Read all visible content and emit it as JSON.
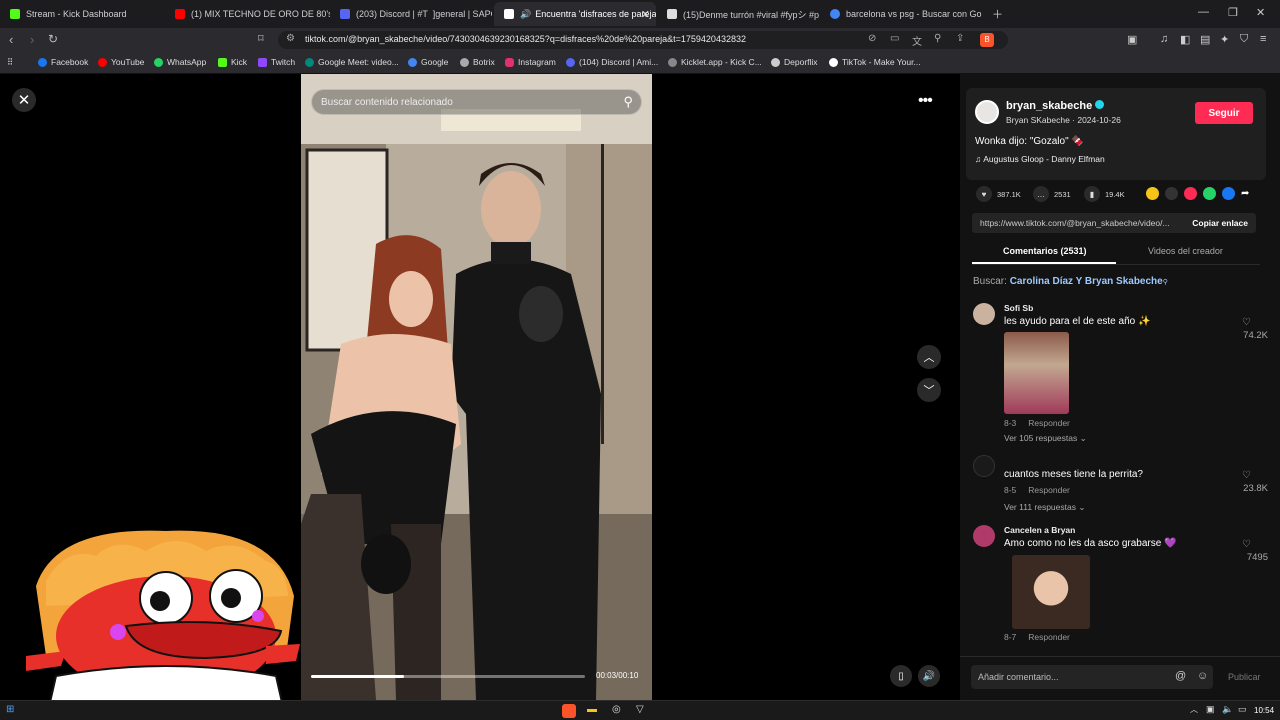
{
  "browser": {
    "tabs": [
      {
        "title": "Stream - Kick Dashboard",
        "color": "#53fc18",
        "active": false
      },
      {
        "title": "(1) MIX TECHNO DE ORO DE 80's &",
        "color": "#ff0000",
        "active": false
      },
      {
        "title": "(203) Discord | #T ⁣ ]general | SAPO",
        "color": "#5865f2",
        "active": false
      },
      {
        "title": "Encuentra 'disfraces de pareja",
        "color": "#ffffff",
        "active": true
      },
      {
        "title": "(15)Denme turrón #viral #fypシ #pen",
        "color": "#ffffff",
        "active": false
      },
      {
        "title": "barcelona vs psg - Buscar con Google",
        "color": "#4285f4",
        "active": false
      }
    ],
    "url": "tiktok.com/@bryan_skabeche/video/7430304639230168325?q=disfraces%20de%20pareja&t=1759420432832",
    "bookmarks": [
      {
        "label": "Facebook",
        "color": "#1877f2"
      },
      {
        "label": "YouTube",
        "color": "#ff0000"
      },
      {
        "label": "WhatsApp",
        "color": "#25d366"
      },
      {
        "label": "Kick",
        "color": "#53fc18"
      },
      {
        "label": "Twitch",
        "color": "#9146ff"
      },
      {
        "label": "Google Meet: video...",
        "color": "#00897b"
      },
      {
        "label": "Google",
        "color": "#4285f4"
      },
      {
        "label": "Botrix",
        "color": "#aaaaaa"
      },
      {
        "label": "Instagram",
        "color": "#e1306c"
      },
      {
        "label": "(104) Discord | Ami...",
        "color": "#5865f2"
      },
      {
        "label": "Kicklet.app - Kick C...",
        "color": "#888888"
      },
      {
        "label": "Deporflix",
        "color": "#cccccc"
      },
      {
        "label": "TikTok - Make Your...",
        "color": "#ffffff"
      }
    ]
  },
  "video": {
    "search_placeholder": "Buscar contenido relacionado",
    "time": "00:03/00:10",
    "progress": 0.34
  },
  "creator": {
    "username": "bryan_skabeche",
    "subline": "Bryan SKabeche · 2024-10-26",
    "follow_label": "Seguir",
    "caption": "Wonka dijo: \"Gozalo\" 🍫",
    "music": "♫  Augustus Gloop - Danny Elfman"
  },
  "stats": {
    "likes": "387.1K",
    "comments": "2531",
    "saves": "19.4K"
  },
  "link": {
    "url": "https://www.tiktok.com/@bryan_skabeche/video/...",
    "copy_label": "Copiar enlace"
  },
  "panel_tabs": {
    "comments": "Comentarios (2531)",
    "creator_videos": "Videos del creador"
  },
  "search_suggestion": {
    "prefix": "Buscar:",
    "query": "Carolina Díaz Y Bryan Skabeche"
  },
  "comments": [
    {
      "user": "Sofi Sb",
      "text": "les ayudo para el de este año ✨",
      "date": "8-3",
      "reply": "Responder",
      "replies": "Ver 105 respuestas ⌄",
      "likes": "74.2K"
    },
    {
      "user": "",
      "text": "cuantos meses tiene la perrita?",
      "date": "8-5",
      "reply": "Responder",
      "replies": "Ver 111 respuestas ⌄",
      "likes": "23.8K"
    },
    {
      "user": "Cancelen a Bryan",
      "text": "Amo como no les da asco grabarse 💜",
      "date": "8-7",
      "reply": "Responder",
      "replies": "",
      "likes": "7495"
    }
  ],
  "add_comment": {
    "placeholder": "Añadir comentario...",
    "publish_label": "Publicar"
  },
  "taskbar": {
    "clock": "10:54"
  },
  "icons": {
    "close": "close-icon",
    "more": "more-icon",
    "up": "chevron-up-icon",
    "down": "chevron-down-icon",
    "volume": "volume-icon",
    "pip": "picture-in-picture-icon"
  }
}
